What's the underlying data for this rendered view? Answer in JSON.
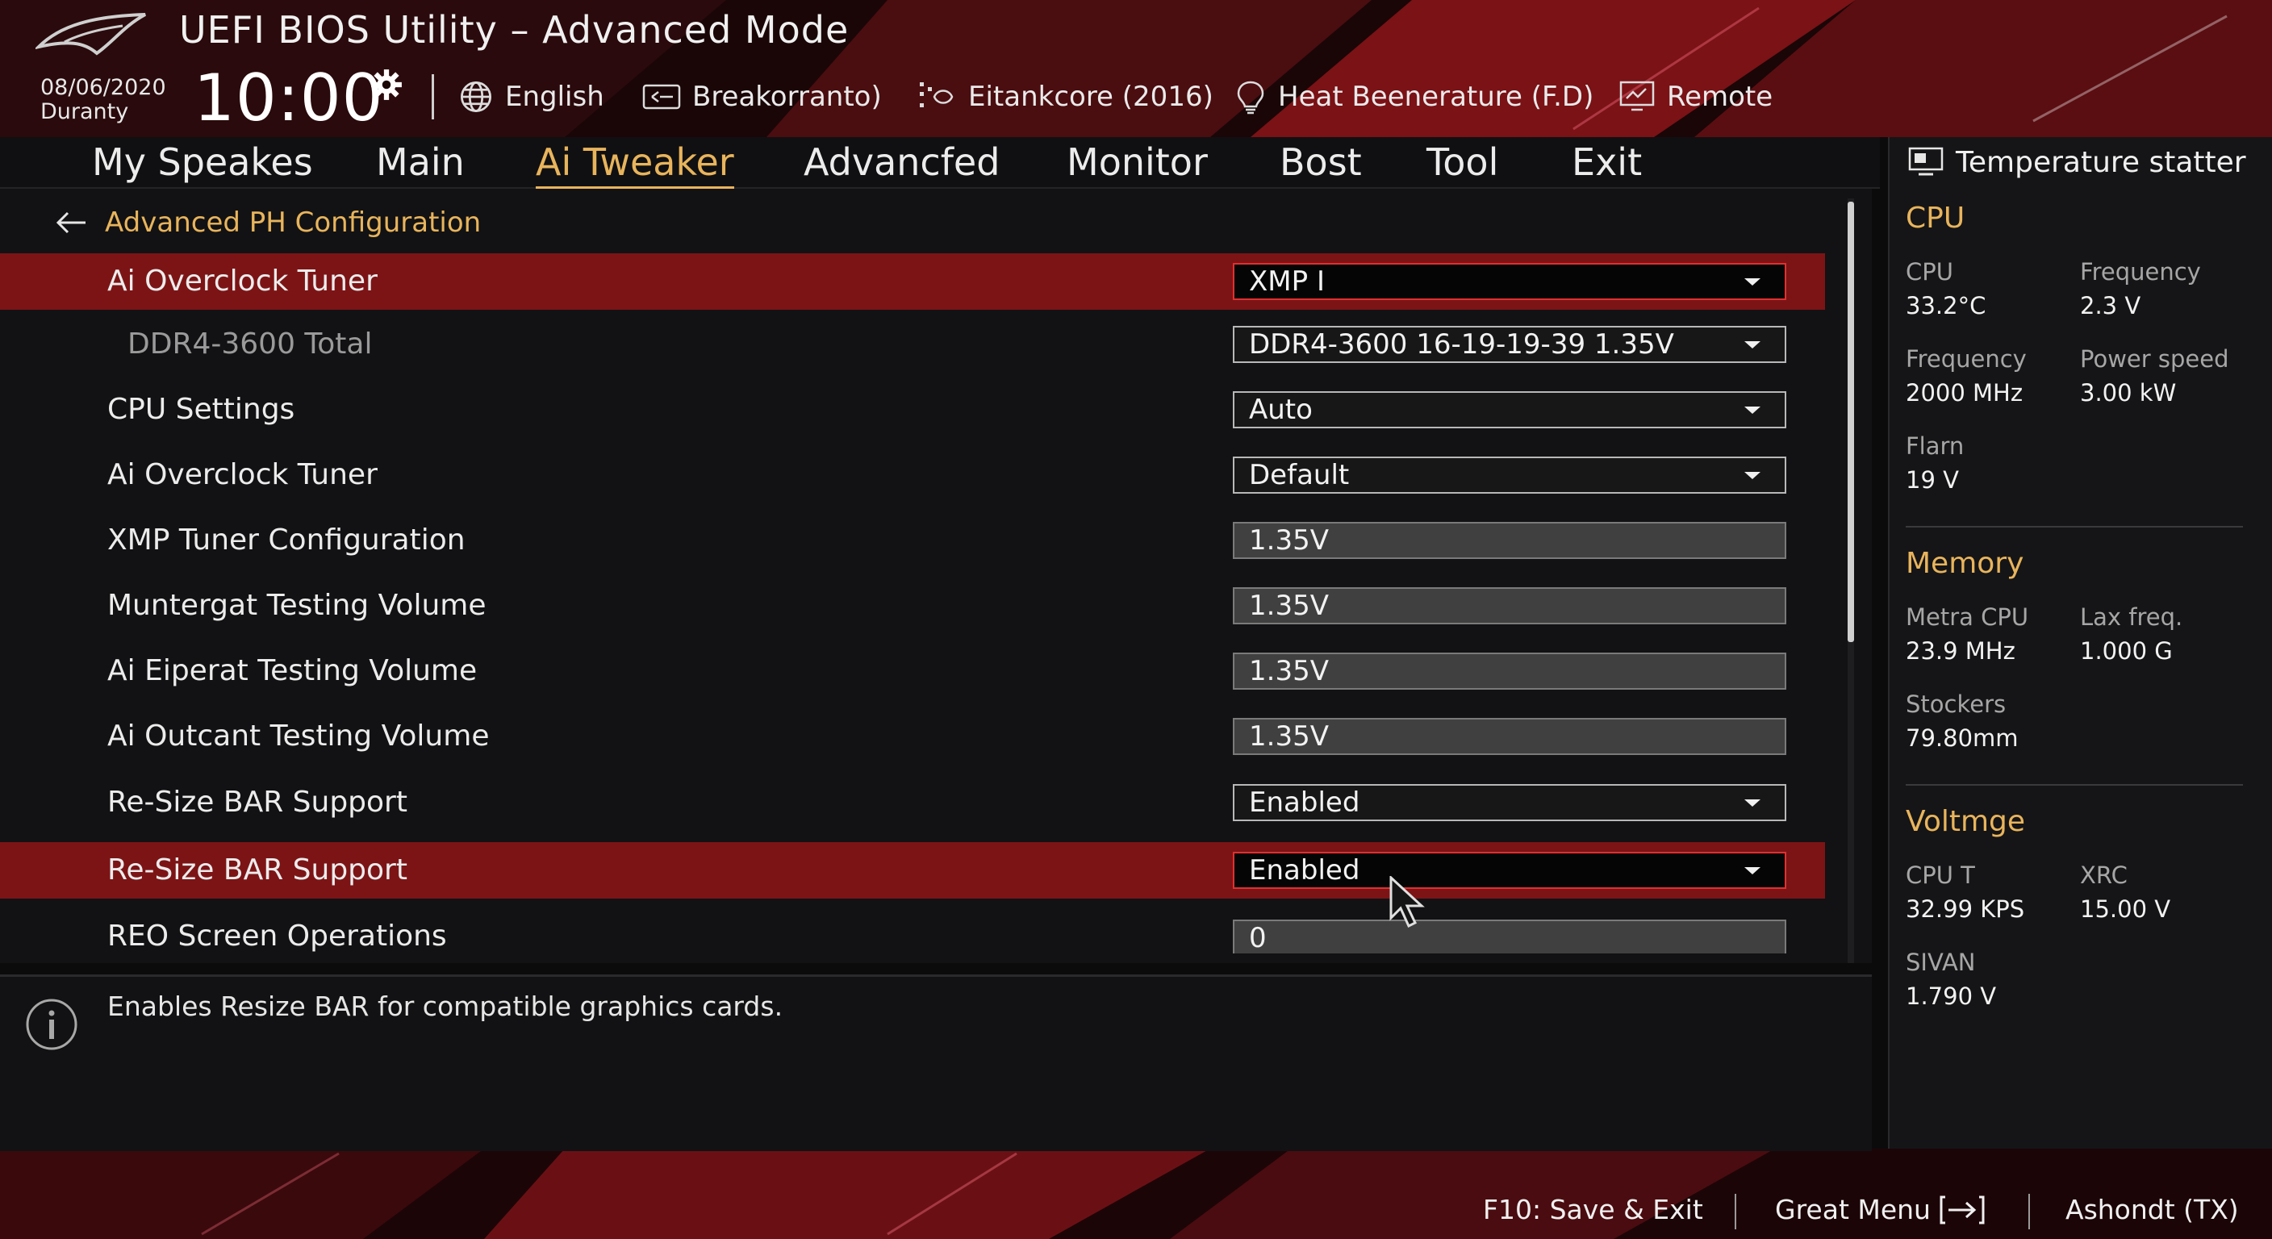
{
  "header": {
    "app_title": "UEFI BIOS Utility – Advanced Mode",
    "date": "08/06/2020",
    "day": "Duranty",
    "time": "10:00",
    "items": [
      {
        "label": "English",
        "icon": "globe-icon"
      },
      {
        "label": "Breakorranto)",
        "icon": "keyboard-icon"
      },
      {
        "label": "Eitankcore (2016)",
        "icon": "fan-icon"
      },
      {
        "label": "Heat Beenerature (F.D)",
        "icon": "bulb-icon"
      },
      {
        "label": "Remote",
        "icon": "monitor-icon"
      }
    ]
  },
  "nav": {
    "tabs": [
      "My Speakes",
      "Main",
      "Ai Tweaker",
      "Advancfed",
      "Monitor",
      "Bost",
      "Tool",
      "Exit"
    ],
    "active": "Ai Tweaker"
  },
  "main": {
    "breadcrumb": "Advanced PH Configuration",
    "rows": [
      {
        "label": "Ai Overclock Tuner",
        "value": "XMP I",
        "control": "dropdown",
        "highlighted": true
      },
      {
        "label": "DDR4-3600 Total",
        "value": "DDR4-3600 16-19-19-39 1.35V",
        "control": "dropdown",
        "dimmed": true
      },
      {
        "label": "CPU Settings",
        "value": "Auto",
        "control": "dropdown"
      },
      {
        "label": "Ai Overclock Tuner",
        "value": "Default",
        "control": "dropdown"
      },
      {
        "label": "XMP Tuner Configuration",
        "value": "1.35V",
        "control": "text"
      },
      {
        "label": "Muntergat Testing Volume",
        "value": "1.35V",
        "control": "text"
      },
      {
        "label": "Ai Eiperat Testing Volume",
        "value": "1.35V",
        "control": "text"
      },
      {
        "label": "Ai Outcant Testing Volume",
        "value": "1.35V",
        "control": "text"
      },
      {
        "label": "Re-Size BAR Support",
        "value": "Enabled",
        "control": "dropdown"
      },
      {
        "label": "Re-Size BAR Support",
        "value": "Enabled",
        "control": "dropdown",
        "highlighted": true
      },
      {
        "label": "REO Screen Operations",
        "value": "0",
        "control": "text"
      }
    ]
  },
  "info": {
    "text": "Enables Resize BAR for compatible graphics cards."
  },
  "status_panel": {
    "title": "Temperature statter",
    "sections": [
      {
        "heading": "CPU",
        "stats": [
          {
            "label": "CPU",
            "value": "33.2°C"
          },
          {
            "label": "Frequency",
            "value": "2.3 V"
          },
          {
            "label": "Frequency",
            "value": "2000 MHz"
          },
          {
            "label": "Power speed",
            "value": "3.00 kW"
          },
          {
            "label": "Flarn",
            "value": "19 V"
          }
        ]
      },
      {
        "heading": "Memory",
        "stats": [
          {
            "label": "Metra CPU",
            "value": "23.9 MHz"
          },
          {
            "label": "Lax freq.",
            "value": "1.000 G"
          },
          {
            "label": "Stockers",
            "value": "79.80mm"
          }
        ]
      },
      {
        "heading": "Voltmge",
        "stats": [
          {
            "label": "CPU T",
            "value": "32.99 KPS"
          },
          {
            "label": "XRC",
            "value": "15.00 V"
          },
          {
            "label": "SIVAN",
            "value": "1.790 V"
          }
        ]
      }
    ]
  },
  "footer": {
    "items": [
      "F10: Save & Exit",
      "Great Menu",
      "Ashondt (TX)"
    ]
  },
  "colors": {
    "accent": "#e8b45c",
    "highlight_row": "#7c1416",
    "highlight_border": "#e03030",
    "background": "#0b0b0c"
  }
}
